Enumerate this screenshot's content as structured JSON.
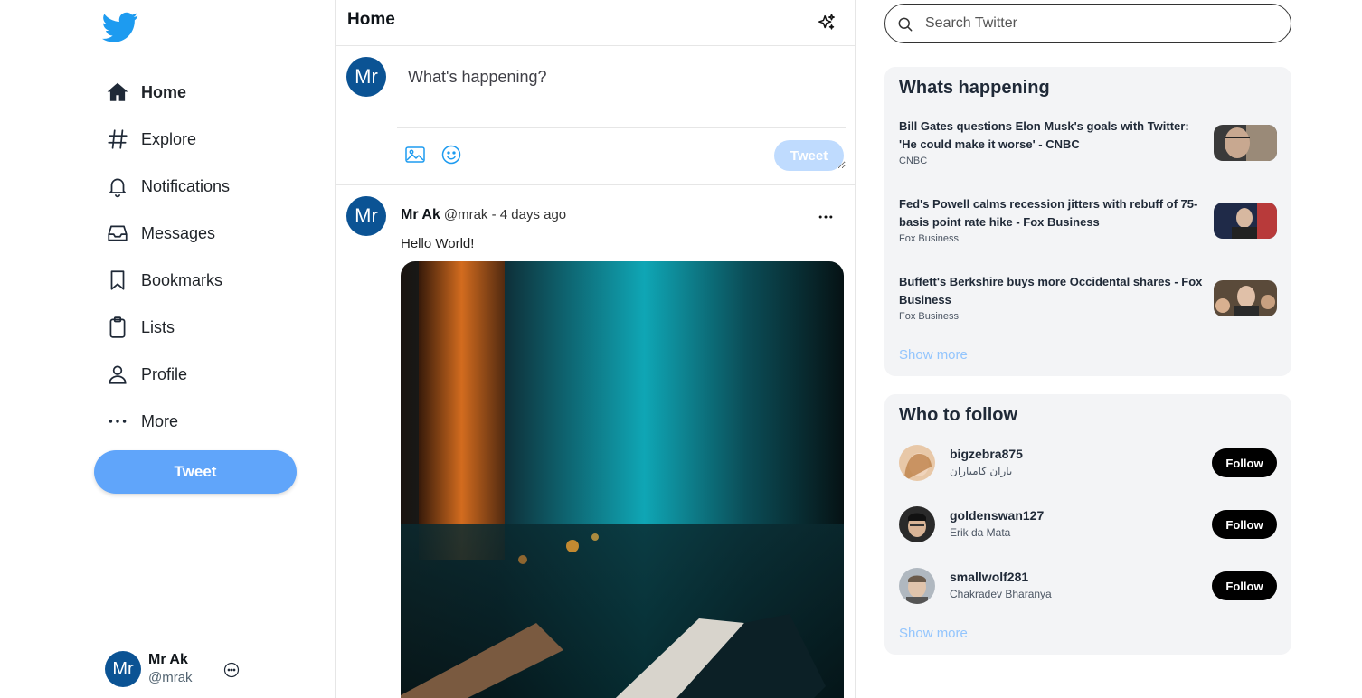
{
  "sidebar": {
    "logo": "twitter-bird-icon",
    "items": [
      {
        "label": "Home",
        "icon": "home-icon"
      },
      {
        "label": "Explore",
        "icon": "hashtag-icon"
      },
      {
        "label": "Notifications",
        "icon": "bell-icon"
      },
      {
        "label": "Messages",
        "icon": "inbox-icon"
      },
      {
        "label": "Bookmarks",
        "icon": "bookmark-icon"
      },
      {
        "label": "Lists",
        "icon": "clipboard-icon"
      },
      {
        "label": "Profile",
        "icon": "user-icon"
      },
      {
        "label": "More",
        "icon": "more-dots-icon"
      }
    ],
    "tweet_label": "Tweet",
    "me": {
      "avatar": "Mr",
      "name": "Mr Ak",
      "handle": "@mrak"
    }
  },
  "main": {
    "title": "Home",
    "composer": {
      "avatar": "Mr",
      "placeholder": "What's happening?",
      "tweet_label": "Tweet"
    },
    "post": {
      "avatar": "Mr",
      "name": "Mr Ak",
      "meta": "@mrak - 4 days ago",
      "text": "Hello World!"
    }
  },
  "right": {
    "search_placeholder": "Search Twitter",
    "happening": {
      "title": "Whats happening",
      "items": [
        {
          "title": "Bill Gates questions Elon Musk's goals with Twitter: 'He could make it worse' - CNBC",
          "source": "CNBC"
        },
        {
          "title": "Fed's Powell calms recession jitters with rebuff of 75-basis point rate hike - Fox Business",
          "source": "Fox Business"
        },
        {
          "title": "Buffett's Berkshire buys more Occidental shares - Fox Business",
          "source": "Fox Business"
        }
      ],
      "show_more": "Show more"
    },
    "follow": {
      "title": "Who to follow",
      "users": [
        {
          "username": "bigzebra875",
          "name": "باران کامیاران"
        },
        {
          "username": "goldenswan127",
          "name": "Erik da Mata"
        },
        {
          "username": "smallwolf281",
          "name": "Chakradev Bharanya"
        }
      ],
      "follow_label": "Follow",
      "show_more": "Show more"
    }
  },
  "colors": {
    "brand": "#1d9bf0",
    "tweet_button": "#60a5fa",
    "tweet_button_disabled": "#bfdbfe",
    "avatar_bg": "#0b5394",
    "link": "#93c5fd"
  }
}
